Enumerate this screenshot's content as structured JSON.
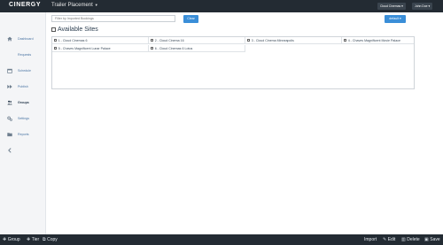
{
  "header": {
    "logo": "CINERGY",
    "app_title": "Trailer Placement",
    "theater_select": "Cloud Cinemas ▾",
    "user_select": "John Doe ▾"
  },
  "sidebar": {
    "items": [
      {
        "label": "Dashboard",
        "icon": "home-icon"
      },
      {
        "label": "Requests",
        "icon": ""
      },
      {
        "label": "Schedule",
        "icon": "calendar-icon"
      },
      {
        "label": "Publish",
        "icon": "fast-forward-icon"
      },
      {
        "label": "Groups",
        "icon": "users-icon"
      },
      {
        "label": "Settings",
        "icon": "gears-icon"
      },
      {
        "label": "Reports",
        "icon": "folder-icon"
      }
    ],
    "collapse_icon": "chevron-left-icon"
  },
  "toolbar": {
    "filter_placeholder": "Filter by Imported Bookings",
    "clear_label": "Clear",
    "default_label": "default ▾"
  },
  "sites": {
    "heading": "Available Sites",
    "items": [
      "1 - Cloud Cinemas 6",
      "2 - Cloud Cinema 16",
      "3 - Cloud Cinema Minneapolis",
      "4 - Chaves Magnificent Movie Palace",
      "5 - Chaves Magnificent Lunar Palace",
      "6 - Cloud Cinemas 6 Lotus"
    ]
  },
  "bottombar": {
    "group_label": "Group",
    "tier_label": "Tier",
    "copy_label": "Copy",
    "import_label": "Import",
    "edit_label": "Edit",
    "delete_label": "Delete",
    "save_label": "Save"
  }
}
